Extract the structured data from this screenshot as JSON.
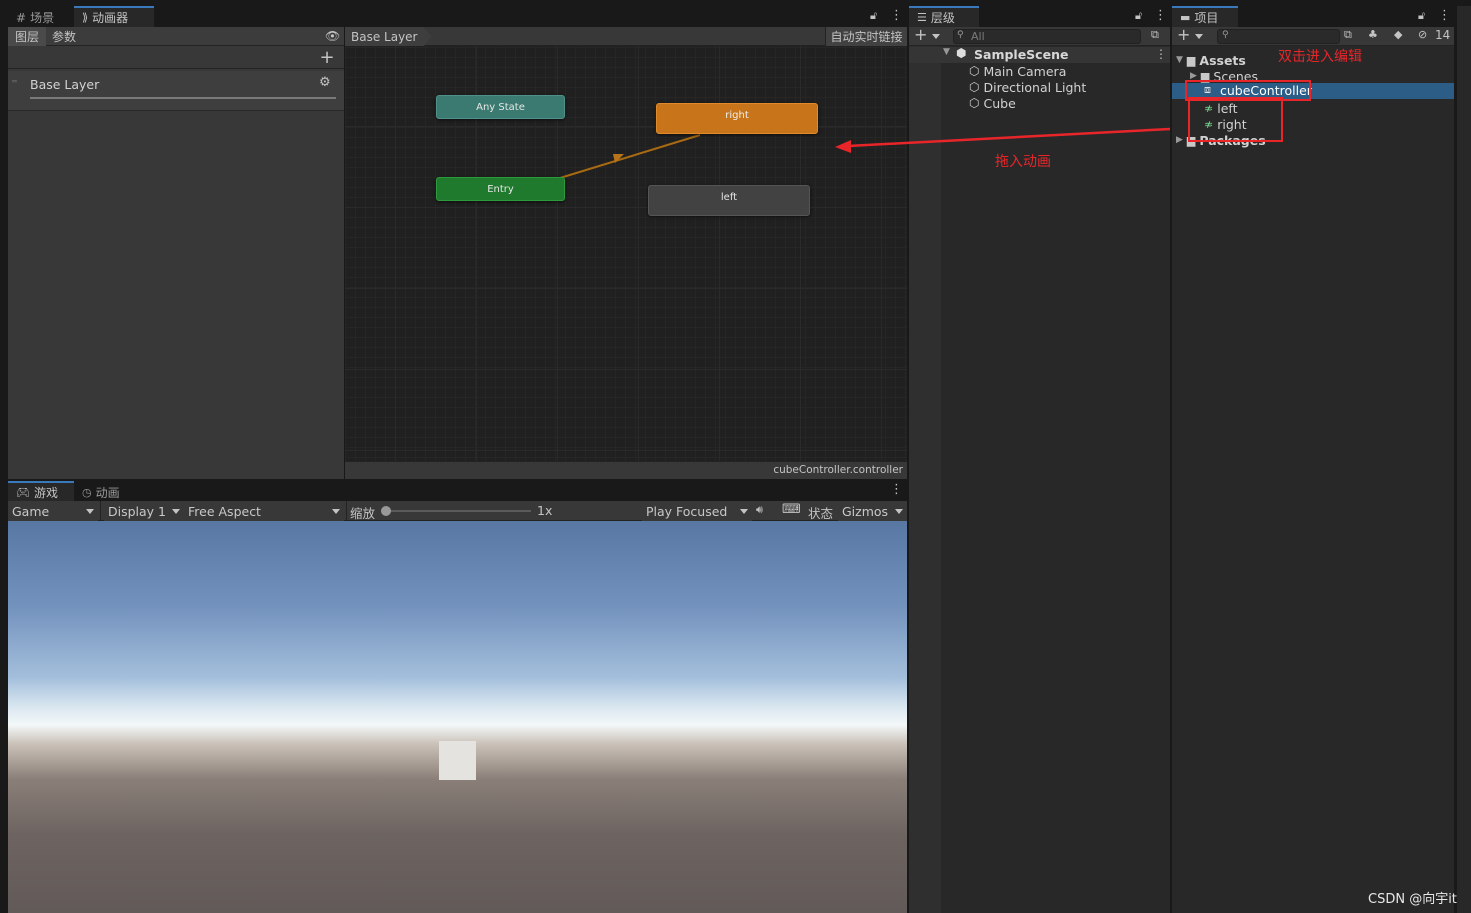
{
  "animator_window": {
    "tabs": [
      {
        "label": "场景",
        "icon": "grid-icon"
      },
      {
        "label": "动画器",
        "icon": "animator-icon"
      }
    ],
    "left_tabs": [
      "图层",
      "参数"
    ],
    "layer_name": "Base Layer",
    "breadcrumb": "Base Layer",
    "auto_live_link": "自动实时链接",
    "footer_file": "cubeController.controller",
    "nodes": {
      "any_state": "Any State",
      "entry": "Entry",
      "right": "right",
      "left": "left"
    }
  },
  "game_window": {
    "tabs": [
      {
        "label": "游戏",
        "icon": "gamepad-icon"
      },
      {
        "label": "动画",
        "icon": "animation-clock-icon"
      }
    ],
    "game_dropdown": "Game",
    "display_dropdown": "Display 1",
    "aspect_dropdown": "Free Aspect",
    "scale_label": "缩放",
    "scale_value": "1x",
    "play_mode": "Play Focused",
    "stats_label": "状态",
    "gizmos_label": "Gizmos"
  },
  "hierarchy": {
    "tab_label": "层级",
    "search_placeholder": "All",
    "scene": "SampleScene",
    "items": [
      "Main Camera",
      "Directional Light",
      "Cube"
    ]
  },
  "project": {
    "tab_label": "项目",
    "hidden_count": "14",
    "root": "Assets",
    "items": [
      {
        "label": "Scenes",
        "type": "folder"
      },
      {
        "label": "cubeController",
        "type": "controller"
      },
      {
        "label": "left",
        "type": "anim"
      },
      {
        "label": "right",
        "type": "anim"
      }
    ],
    "packages": "Packages"
  },
  "annotations": {
    "double_click": "双击进入编辑",
    "drag_in": "拖入动画",
    "color": "#e8262a"
  },
  "watermark": "CSDN @向宇it",
  "colors": {
    "accent": "#3a79bb",
    "selection": "#2c5d87",
    "any_state": "#3b7a70",
    "entry": "#1f7a2e",
    "default_state": "#c7741a",
    "state": "#424242"
  }
}
